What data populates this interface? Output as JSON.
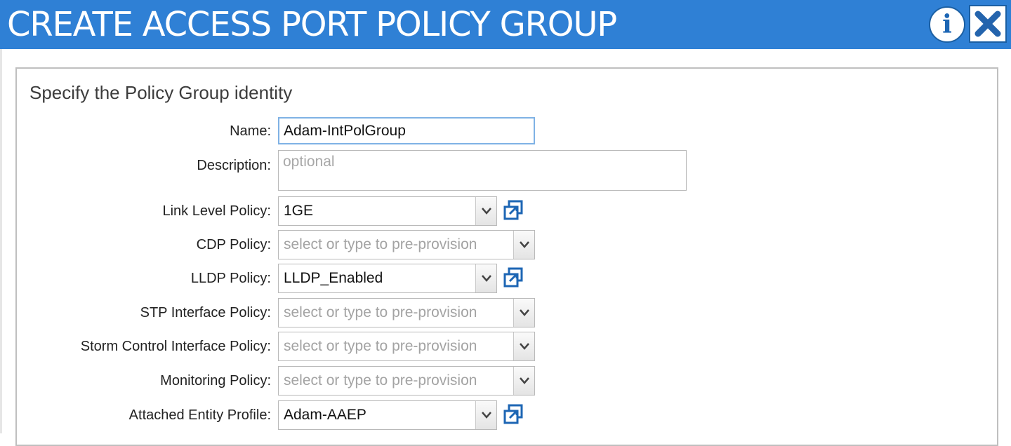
{
  "dialog": {
    "title": "CREATE ACCESS PORT POLICY GROUP",
    "info_icon": "info-icon",
    "info_glyph": "i",
    "close_icon": "close-icon"
  },
  "section": {
    "title": "Specify the Policy Group identity"
  },
  "fields": {
    "name": {
      "label": "Name:",
      "value": "Adam-IntPolGroup"
    },
    "description": {
      "label": "Description:",
      "placeholder": "optional"
    },
    "link_level": {
      "label": "Link Level Policy:",
      "value": "1GE"
    },
    "cdp": {
      "label": "CDP Policy:",
      "placeholder": "select or type to pre-provision"
    },
    "lldp": {
      "label": "LLDP Policy:",
      "value": "LLDP_Enabled"
    },
    "stp": {
      "label": "STP Interface Policy:",
      "placeholder": "select or type to pre-provision"
    },
    "storm": {
      "label": "Storm Control Interface Policy:",
      "placeholder": "select or type to pre-provision"
    },
    "monitoring": {
      "label": "Monitoring Policy:",
      "placeholder": "select or type to pre-provision"
    },
    "aaep": {
      "label": "Attached Entity Profile:",
      "value": "Adam-AAEP"
    }
  },
  "icons": {
    "dropdown": "chevron-down-icon",
    "open_policy": "open-policy-icon"
  },
  "colors": {
    "titlebar": "#2f80d5",
    "accent_icon": "#1d66b4",
    "placeholder": "#a3a3a3"
  }
}
